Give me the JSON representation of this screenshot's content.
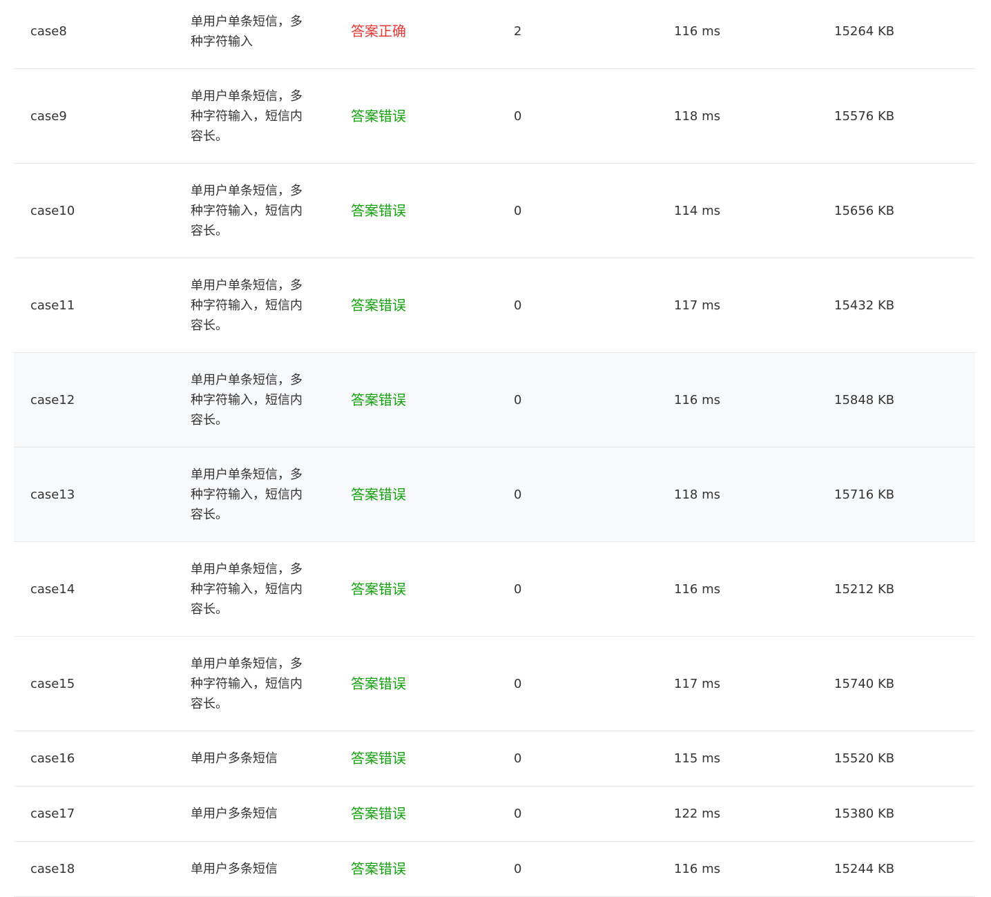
{
  "colors": {
    "correct": "#e53935",
    "wrong": "#13a10e"
  },
  "rows": [
    {
      "case": "case8",
      "desc": "单用户单条短信，多种字符输入",
      "status": "答案正确",
      "status_kind": "correct",
      "score": "2",
      "time": "116 ms",
      "memory": "15264 KB"
    },
    {
      "case": "case9",
      "desc": "单用户单条短信，多种字符输入，短信内容长。",
      "status": "答案错误",
      "status_kind": "wrong",
      "score": "0",
      "time": "118 ms",
      "memory": "15576 KB"
    },
    {
      "case": "case10",
      "desc": "单用户单条短信，多种字符输入，短信内容长。",
      "status": "答案错误",
      "status_kind": "wrong",
      "score": "0",
      "time": "114 ms",
      "memory": "15656 KB"
    },
    {
      "case": "case11",
      "desc": "单用户单条短信，多种字符输入，短信内容长。",
      "status": "答案错误",
      "status_kind": "wrong",
      "score": "0",
      "time": "117 ms",
      "memory": "15432 KB"
    },
    {
      "case": "case12",
      "desc": "单用户单条短信，多种字符输入，短信内容长。",
      "status": "答案错误",
      "status_kind": "wrong",
      "score": "0",
      "time": "116 ms",
      "memory": "15848 KB"
    },
    {
      "case": "case13",
      "desc": "单用户单条短信，多种字符输入，短信内容长。",
      "status": "答案错误",
      "status_kind": "wrong",
      "score": "0",
      "time": "118 ms",
      "memory": "15716 KB"
    },
    {
      "case": "case14",
      "desc": "单用户单条短信，多种字符输入，短信内容长。",
      "status": "答案错误",
      "status_kind": "wrong",
      "score": "0",
      "time": "116 ms",
      "memory": "15212 KB"
    },
    {
      "case": "case15",
      "desc": "单用户单条短信，多种字符输入，短信内容长。",
      "status": "答案错误",
      "status_kind": "wrong",
      "score": "0",
      "time": "117 ms",
      "memory": "15740 KB"
    },
    {
      "case": "case16",
      "desc": "单用户多条短信",
      "status": "答案错误",
      "status_kind": "wrong",
      "score": "0",
      "time": "115 ms",
      "memory": "15520 KB"
    },
    {
      "case": "case17",
      "desc": "单用户多条短信",
      "status": "答案错误",
      "status_kind": "wrong",
      "score": "0",
      "time": "122 ms",
      "memory": "15380 KB"
    },
    {
      "case": "case18",
      "desc": "单用户多条短信",
      "status": "答案错误",
      "status_kind": "wrong",
      "score": "0",
      "time": "116 ms",
      "memory": "15244 KB"
    }
  ]
}
